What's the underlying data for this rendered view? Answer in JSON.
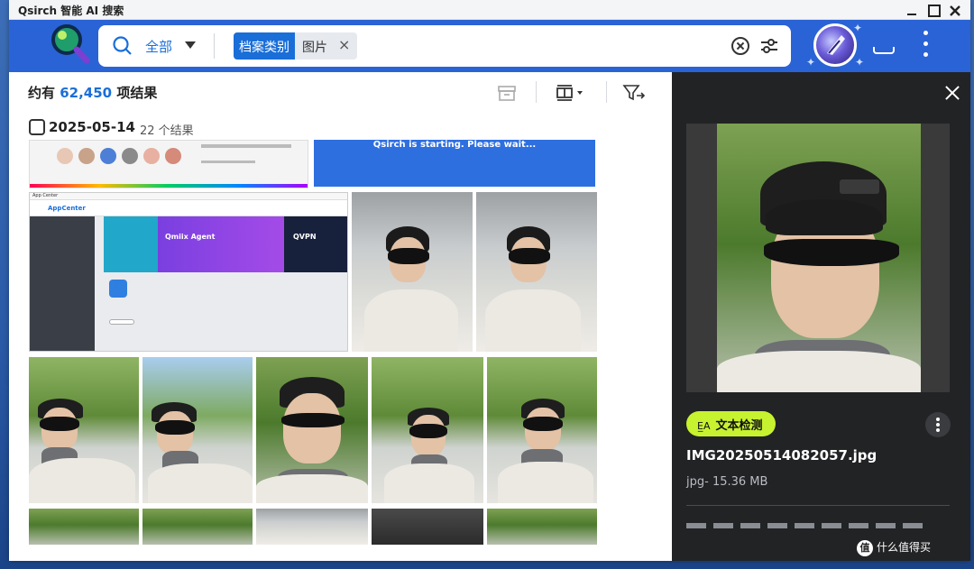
{
  "window": {
    "title": "Qsirch 智能 AI 搜索"
  },
  "search": {
    "scope_label": "全部",
    "chip_key": "档案类别",
    "chip_value": "图片",
    "chip_remove": "×"
  },
  "results": {
    "count_prefix": "约有 ",
    "count_value": "62,450",
    "count_suffix": " 项结果",
    "date_group": {
      "date": "2025-05-14",
      "count_label": "22 个结果"
    }
  },
  "thumbnails": {
    "wait_message": "Qsirch is starting. Please wait...",
    "app_center": {
      "title": "App Center",
      "brand": "AppCenter",
      "banner1": "Qmiix Agent",
      "banner2": "QVPN"
    }
  },
  "preview": {
    "ocr_button": "文本检测",
    "ocr_icon_text": "E̲A",
    "file_name": "IMG20250514082057.jpg",
    "file_meta": "jpg- 15.36 MB"
  },
  "watermark": {
    "icon_text": "值",
    "text": "什么值得买"
  },
  "colors": {
    "accent": "#1a6ed8",
    "header": "#2a63d6",
    "ocr_button": "#c7f22f",
    "panel_bg": "#222325"
  },
  "icons": [
    "search-icon",
    "chevron-down-icon",
    "close-icon",
    "clear-circle-icon",
    "filter-sliders-icon",
    "archive-icon",
    "layout-icon",
    "filter-funnel-icon",
    "more-vertical-icon",
    "tray-icon"
  ]
}
